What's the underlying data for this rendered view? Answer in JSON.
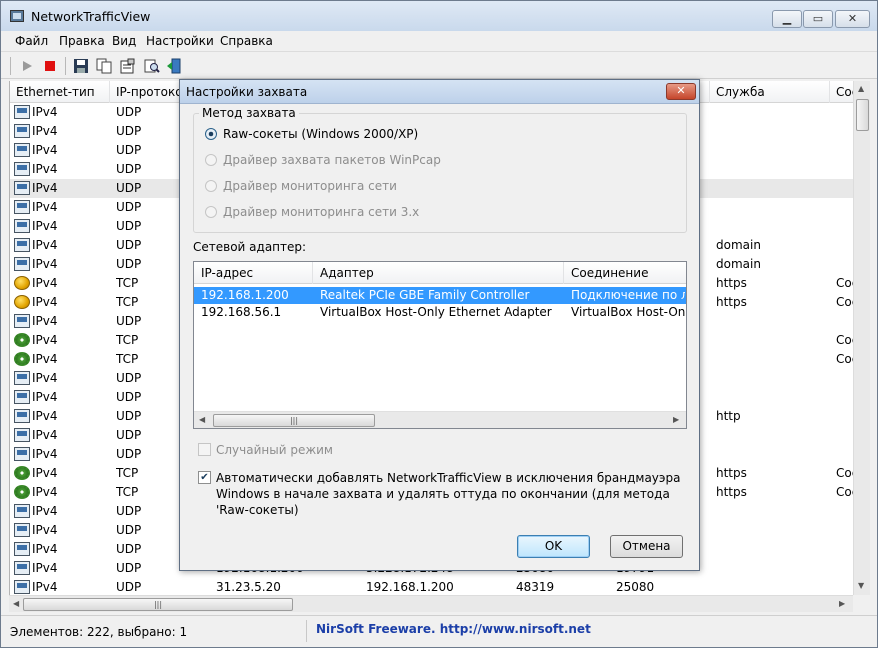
{
  "window": {
    "title": "NetworkTrafficView"
  },
  "menu": [
    "Файл",
    "Правка",
    "Вид",
    "Настройки",
    "Справка"
  ],
  "toolbar": [
    "play-icon",
    "stop-icon",
    "save-icon",
    "copy-icon",
    "properties-icon",
    "find-icon",
    "exit-icon"
  ],
  "list": {
    "columns": [
      "Ethernet-тип",
      "IP-протокол",
      "",
      "",
      "",
      "",
      "Служба",
      "Сое"
    ],
    "rows": [
      {
        "icon": "nic",
        "eth": "IPv4",
        "proto": "UDP",
        "c3": "",
        "c4": "",
        "c5": "",
        "c6": "",
        "svc": "",
        "conn": ""
      },
      {
        "icon": "nic",
        "eth": "IPv4",
        "proto": "UDP",
        "c3": "",
        "c4": "",
        "c5": "",
        "c6": "",
        "svc": "",
        "conn": ""
      },
      {
        "icon": "nic",
        "eth": "IPv4",
        "proto": "UDP",
        "c3": "",
        "c4": "",
        "c5": "",
        "c6": "",
        "svc": "",
        "conn": ""
      },
      {
        "icon": "nic",
        "eth": "IPv4",
        "proto": "UDP",
        "c3": "",
        "c4": "",
        "c5": "",
        "c6": "",
        "svc": "",
        "conn": ""
      },
      {
        "icon": "nic",
        "eth": "IPv4",
        "proto": "UDP",
        "c3": "",
        "c4": "",
        "c5": "",
        "c6": "",
        "svc": "",
        "conn": "",
        "selected": true
      },
      {
        "icon": "nic",
        "eth": "IPv4",
        "proto": "UDP",
        "c3": "",
        "c4": "",
        "c5": "",
        "c6": "",
        "svc": "",
        "conn": ""
      },
      {
        "icon": "nic",
        "eth": "IPv4",
        "proto": "UDP",
        "c3": "",
        "c4": "",
        "c5": "",
        "c6": "",
        "svc": "",
        "conn": ""
      },
      {
        "icon": "nic",
        "eth": "IPv4",
        "proto": "UDP",
        "c3": "",
        "c4": "",
        "c5": "",
        "c6": "",
        "svc": "domain",
        "conn": ""
      },
      {
        "icon": "nic",
        "eth": "IPv4",
        "proto": "UDP",
        "c3": "",
        "c4": "",
        "c5": "",
        "c6": "",
        "svc": "domain",
        "conn": ""
      },
      {
        "icon": "tcp",
        "eth": "IPv4",
        "proto": "TCP",
        "c3": "",
        "c4": "",
        "c5": "",
        "c6": "",
        "svc": "https",
        "conn": "Сое"
      },
      {
        "icon": "tcp",
        "eth": "IPv4",
        "proto": "TCP",
        "c3": "",
        "c4": "",
        "c5": "",
        "c6": "",
        "svc": "https",
        "conn": "Сое"
      },
      {
        "icon": "nic",
        "eth": "IPv4",
        "proto": "UDP",
        "c3": "",
        "c4": "",
        "c5": "",
        "c6": "",
        "svc": "",
        "conn": ""
      },
      {
        "icon": "gear",
        "eth": "IPv4",
        "proto": "TCP",
        "c3": "",
        "c4": "",
        "c5": "",
        "c6": "",
        "svc": "",
        "conn": "Сое"
      },
      {
        "icon": "gear",
        "eth": "IPv4",
        "proto": "TCP",
        "c3": "",
        "c4": "",
        "c5": "",
        "c6": "",
        "svc": "",
        "conn": "Сое"
      },
      {
        "icon": "nic",
        "eth": "IPv4",
        "proto": "UDP",
        "c3": "",
        "c4": "",
        "c5": "",
        "c6": "",
        "svc": "",
        "conn": ""
      },
      {
        "icon": "nic",
        "eth": "IPv4",
        "proto": "UDP",
        "c3": "",
        "c4": "",
        "c5": "",
        "c6": "",
        "svc": "",
        "conn": ""
      },
      {
        "icon": "nic",
        "eth": "IPv4",
        "proto": "UDP",
        "c3": "",
        "c4": "",
        "c5": "",
        "c6": "",
        "svc": "http",
        "conn": ""
      },
      {
        "icon": "nic",
        "eth": "IPv4",
        "proto": "UDP",
        "c3": "",
        "c4": "",
        "c5": "",
        "c6": "",
        "svc": "",
        "conn": ""
      },
      {
        "icon": "nic",
        "eth": "IPv4",
        "proto": "UDP",
        "c3": "",
        "c4": "",
        "c5": "",
        "c6": "",
        "svc": "",
        "conn": ""
      },
      {
        "icon": "gear",
        "eth": "IPv4",
        "proto": "TCP",
        "c3": "",
        "c4": "",
        "c5": "",
        "c6": "",
        "svc": "https",
        "conn": "Сое"
      },
      {
        "icon": "gear",
        "eth": "IPv4",
        "proto": "TCP",
        "c3": "",
        "c4": "",
        "c5": "",
        "c6": "",
        "svc": "https",
        "conn": "Сое"
      },
      {
        "icon": "nic",
        "eth": "IPv4",
        "proto": "UDP",
        "c3": "",
        "c4": "",
        "c5": "",
        "c6": "",
        "svc": "",
        "conn": ""
      },
      {
        "icon": "nic",
        "eth": "IPv4",
        "proto": "UDP",
        "c3": "",
        "c4": "",
        "c5": "",
        "c6": "",
        "svc": "",
        "conn": ""
      },
      {
        "icon": "nic",
        "eth": "IPv4",
        "proto": "UDP",
        "c3": "",
        "c4": "",
        "c5": "",
        "c6": "",
        "svc": "",
        "conn": ""
      },
      {
        "icon": "nic",
        "eth": "IPv4",
        "proto": "UDP",
        "c3": "192.168.1.200",
        "c4": "5.228.172.248",
        "c5": "25080",
        "c6": "19791",
        "svc": "",
        "conn": ""
      },
      {
        "icon": "nic",
        "eth": "IPv4",
        "proto": "UDP",
        "c3": "31.23.5.20",
        "c4": "192.168.1.200",
        "c5": "48319",
        "c6": "25080",
        "svc": "",
        "conn": ""
      }
    ]
  },
  "status": {
    "items": "Элементов: 222, выбрано: 1",
    "link": "NirSoft Freeware.  http://www.nirsoft.net"
  },
  "dialog": {
    "title": "Настройки захвата",
    "group_title": "Метод захвата",
    "methods": [
      {
        "label": "Raw-сокеты (Windows 2000/XP)",
        "checked": true,
        "disabled": false
      },
      {
        "label": "Драйвер захвата пакетов WinPcap",
        "checked": false,
        "disabled": true
      },
      {
        "label": "Драйвер мониторинга сети",
        "checked": false,
        "disabled": true
      },
      {
        "label": "Драйвер мониторинга сети 3.x",
        "checked": false,
        "disabled": true
      }
    ],
    "adapter_label": "Сетевой адаптер:",
    "adapter_columns": [
      "IP-адрес",
      "Адаптер",
      "Соединение"
    ],
    "adapters": [
      {
        "ip": "192.168.1.200",
        "name": "Realtek PCIe GBE Family Controller",
        "conn": "Подключение по локальной сети",
        "selected": true
      },
      {
        "ip": "192.168.56.1",
        "name": "VirtualBox Host-Only Ethernet Adapter",
        "conn": "VirtualBox Host-Only Network",
        "selected": false
      }
    ],
    "promiscuous": "Случайный режим",
    "firewall": "Автоматически добавлять NetworkTrafficView в исключения брандмауэра Windows в начале захвата и удалять оттуда по окончании (для метода 'Raw-сокеты)",
    "ok": "OK",
    "cancel": "Отмена"
  }
}
